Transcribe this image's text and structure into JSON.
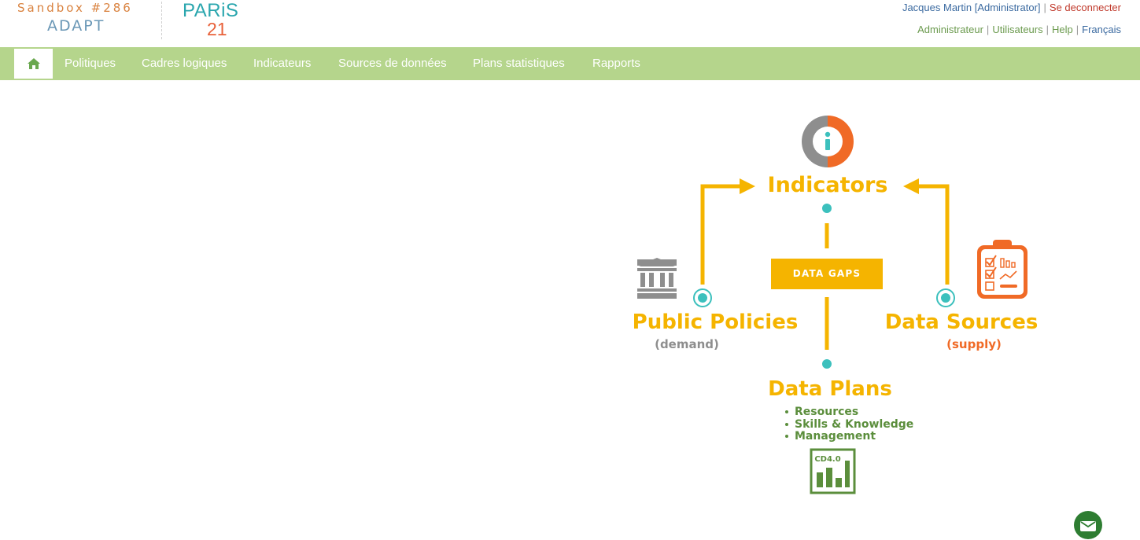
{
  "header": {
    "sandbox_label": "Sandbox #286",
    "app_name": "ADAPT",
    "partner_logo_top": "PARiS",
    "partner_logo_bottom": "21",
    "user": "Jacques Martin [Administrator]",
    "logout_label": "Se deconnecter",
    "admin_links": [
      "Administrateur",
      "Utilisateurs",
      "Help",
      "Français"
    ]
  },
  "nav": {
    "home_icon": "home-icon",
    "items": [
      "Politiques",
      "Cadres logiques",
      "Indicateurs",
      "Sources de données",
      "Plans statistiques",
      "Rapports"
    ]
  },
  "diagram": {
    "indicators_label": "Indicators",
    "data_gaps_label": "DATA GAPS",
    "public_policies_label": "Public Policies",
    "public_policies_sub": "(demand)",
    "data_sources_label": "Data Sources",
    "data_sources_sub": "(supply)",
    "data_plans_label": "Data Plans",
    "data_plans_items": [
      "Resources",
      "Skills & Knowledge",
      "Management"
    ],
    "cd_badge": "CD4.0"
  },
  "colors": {
    "nav_bg": "#b5d58c",
    "accent_yellow": "#f5b400",
    "accent_orange": "#f06a26",
    "teal": "#3cc0bd",
    "green": "#5b8e3c"
  },
  "chat": {
    "icon": "envelope-icon"
  }
}
